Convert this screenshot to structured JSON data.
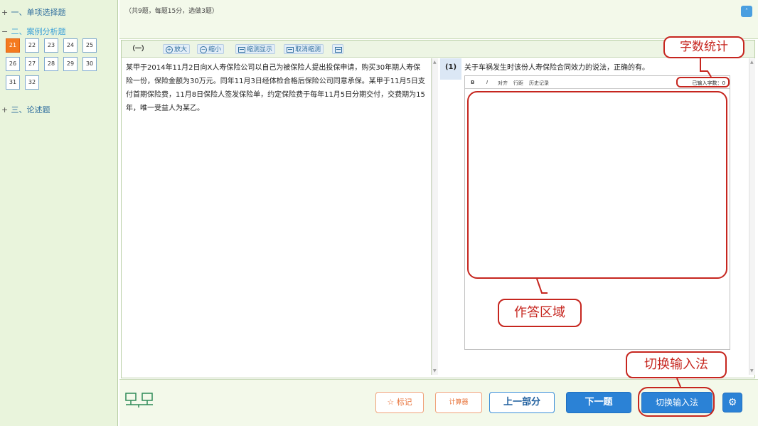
{
  "sidebar": {
    "sections": [
      {
        "marker": "+",
        "label": "一、单项选择题"
      },
      {
        "marker": "−",
        "label": "二、案例分析题"
      },
      {
        "marker": "+",
        "label": "三、论述题"
      }
    ],
    "questions": [
      "21",
      "22",
      "23",
      "24",
      "25",
      "26",
      "27",
      "28",
      "29",
      "30",
      "31",
      "32"
    ],
    "current_question": "21"
  },
  "header": {
    "info": "（共9题，每题15分，选做3题）",
    "collapse_icon": "double-chevron-up-icon"
  },
  "toolbar": {
    "section_label": "（一）",
    "zoom_in": "放大",
    "zoom_out": "缩小",
    "split_view": "缩测显示",
    "cancel_split": "取消缩测"
  },
  "passage": {
    "text": "某甲于2014年11月2日向X人寿保险公司以自己为被保险人提出投保申请，购买30年期人寿保险一份，保险金额为30万元。同年11月3日经体检合格后保险公司同意承保。某甲于11月5日支付首期保险费，11月8日保险人签发保险单，约定保险费于每年11月5日分期交付，交费期为15年，唯一受益人为某乙。"
  },
  "question": {
    "number": "(1)",
    "text": "关于车祸发生时该份人寿保险合同效力的说法，正确的有。"
  },
  "editor": {
    "tools": [
      "B",
      "I",
      "对齐",
      "行距",
      "历史记录"
    ],
    "word_count": "已输入字数：0",
    "answer_value": ""
  },
  "annotations": {
    "word_count_callout": "字数统计",
    "answer_area_callout": "作答区域",
    "ime_callout": "切换输入法"
  },
  "bottom": {
    "mark": "标记",
    "calculator": "计算器",
    "prev_section": "上一部分",
    "next_question": "下一题",
    "switch_ime": "切换输入法",
    "settings_icon": "gear-icon"
  }
}
